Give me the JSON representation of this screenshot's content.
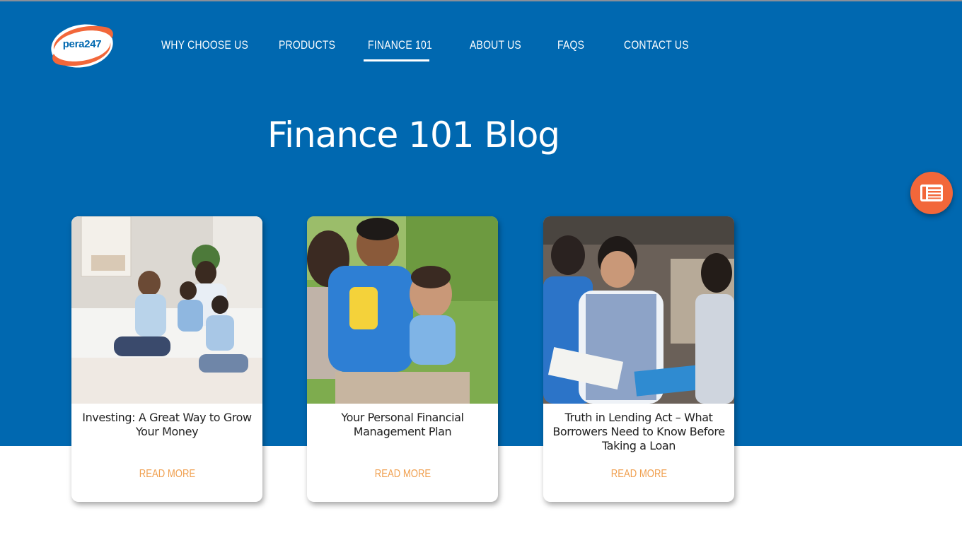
{
  "brand": {
    "logo_text": "pera247"
  },
  "nav": {
    "items": [
      {
        "label": "WHY CHOOSE US"
      },
      {
        "label": "PRODUCTS"
      },
      {
        "label": "FINANCE 101",
        "active": true
      },
      {
        "label": "ABOUT US"
      },
      {
        "label": "FAQS"
      },
      {
        "label": "CONTACT US"
      }
    ]
  },
  "page": {
    "title": "Finance 101 Blog"
  },
  "floating_button": {
    "icon": "newspaper-icon"
  },
  "cards": [
    {
      "title_line1": "Investing: A Great Way to Grow",
      "title_line2": "Your Money",
      "title_line3": "",
      "read_more": "READ MORE"
    },
    {
      "title_line1": "Your Personal Financial",
      "title_line2": "Management Plan",
      "title_line3": "",
      "read_more": "READ MORE"
    },
    {
      "title_line1": "Truth in Lending Act – What",
      "title_line2": "Borrowers Need to Know Before",
      "title_line3": "Taking a Loan",
      "read_more": "READ MORE"
    }
  ],
  "colors": {
    "brand_blue": "#0068b0",
    "accent_orange": "#f2673a",
    "read_more": "#f0a050"
  }
}
